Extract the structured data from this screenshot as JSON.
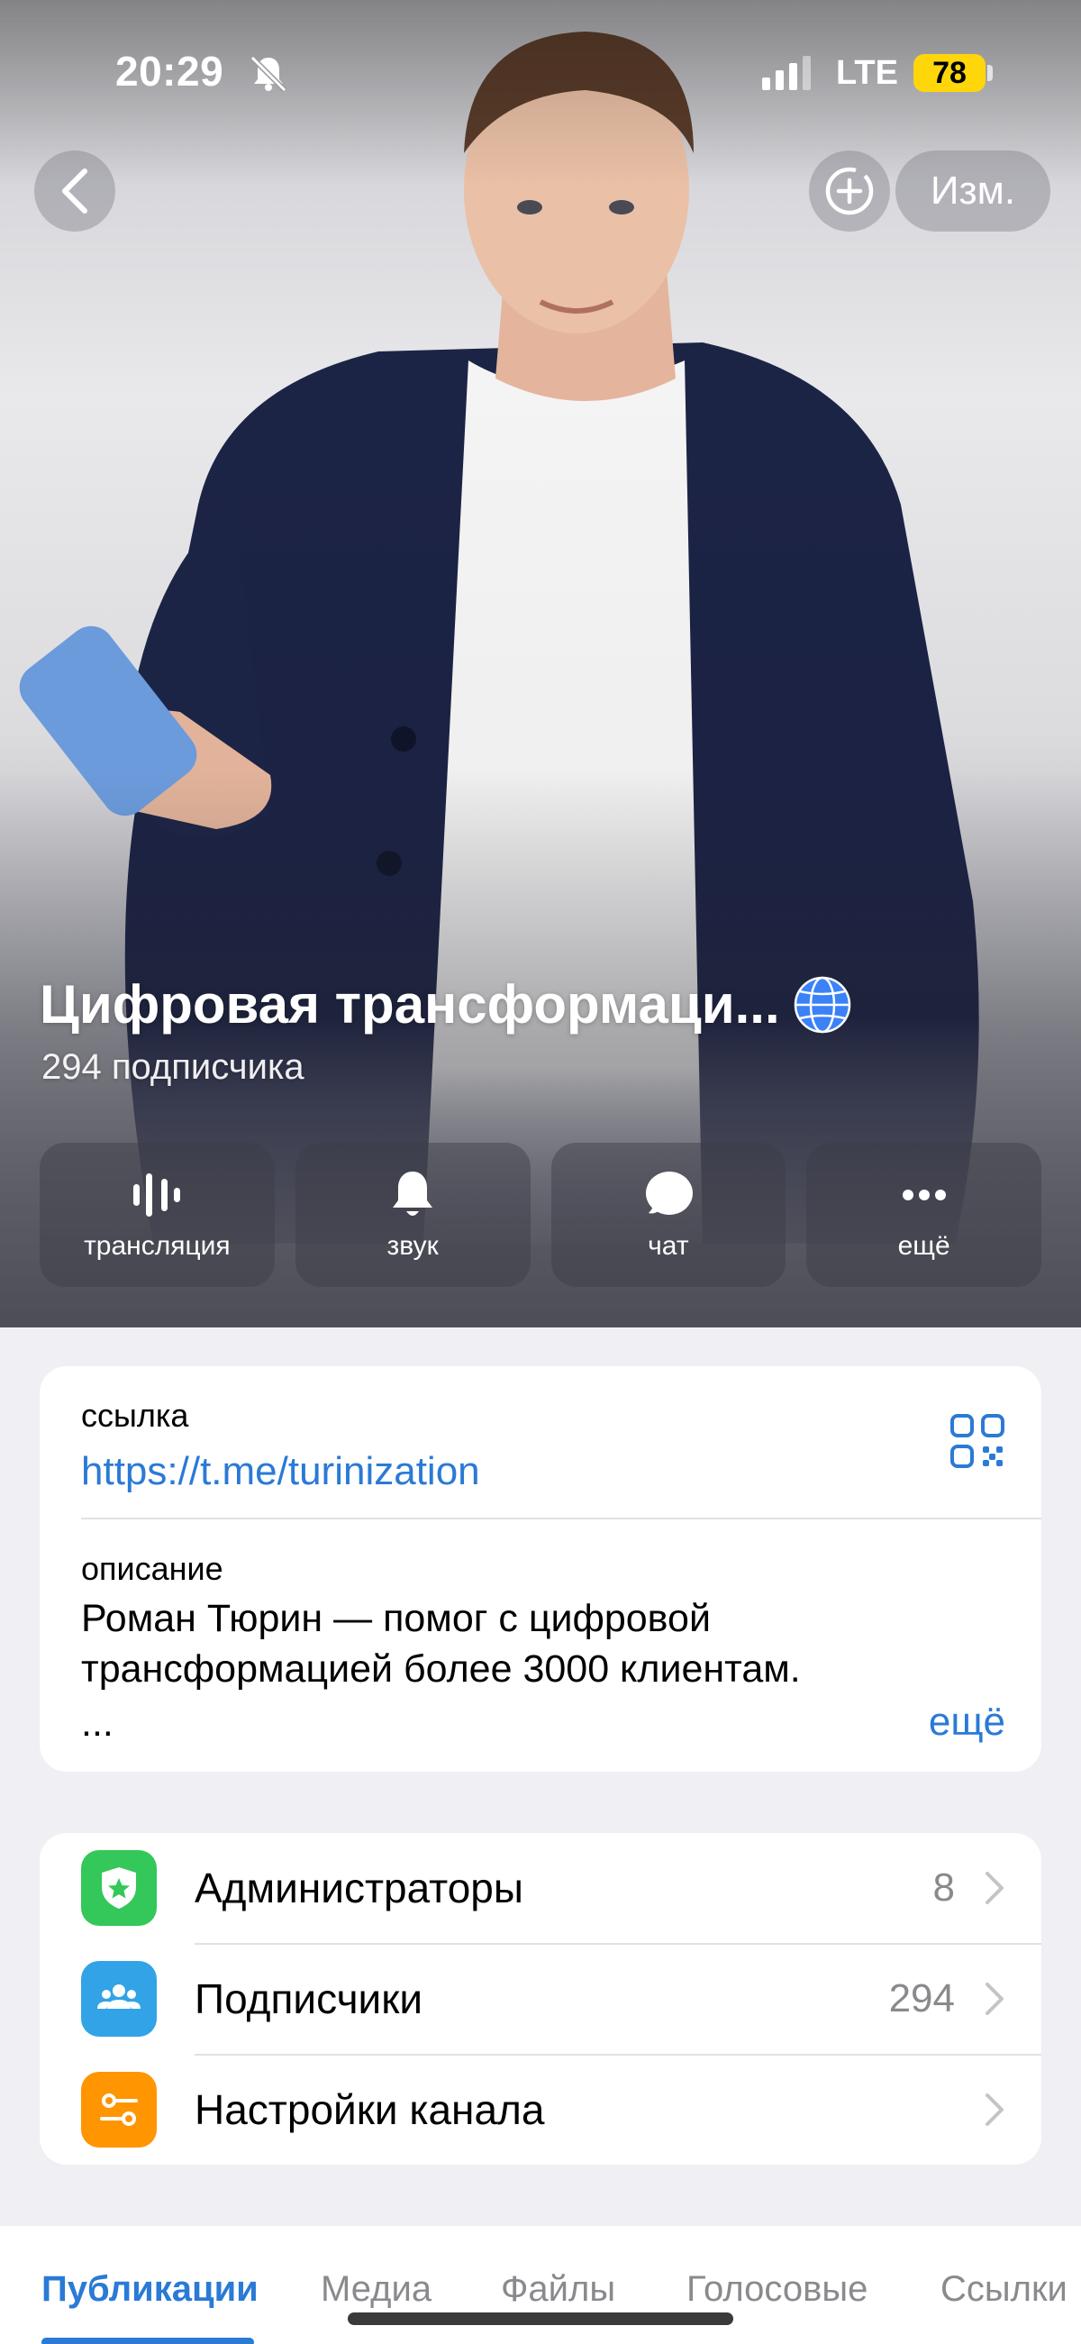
{
  "status_bar": {
    "time": "20:29",
    "network": "LTE",
    "battery": "78"
  },
  "nav": {
    "edit_label": "Изм."
  },
  "channel": {
    "title": "Цифровая трансформаци...",
    "subscribers": "294 подписчика"
  },
  "actions": [
    {
      "label": "трансляция",
      "icon": "stream-icon"
    },
    {
      "label": "звук",
      "icon": "bell-icon"
    },
    {
      "label": "чат",
      "icon": "chat-icon"
    },
    {
      "label": "ещё",
      "icon": "more-icon"
    }
  ],
  "info": {
    "link_label": "ссылка",
    "link": "https://t.me/turinization",
    "description_label": "описание",
    "description": "Роман Тюрин — помог с цифровой трансформацией более 3000 клиентам.",
    "ellipsis": "...",
    "more": "ещё"
  },
  "menu": [
    {
      "label": "Администраторы",
      "value": "8",
      "icon": "admin-shield-icon",
      "color": "#34c759"
    },
    {
      "label": "Подписчики",
      "value": "294",
      "icon": "subscribers-icon",
      "color": "#32a3e6"
    },
    {
      "label": "Настройки канала",
      "value": "",
      "icon": "settings-sliders-icon",
      "color": "#ff9500"
    }
  ],
  "tabs": [
    {
      "label": "Публикации",
      "active": true
    },
    {
      "label": "Медиа",
      "active": false
    },
    {
      "label": "Файлы",
      "active": false
    },
    {
      "label": "Голосовые",
      "active": false
    },
    {
      "label": "Ссылки",
      "active": false
    }
  ],
  "colors": {
    "accent": "#2a7ad6",
    "battery": "#ffd60a"
  }
}
